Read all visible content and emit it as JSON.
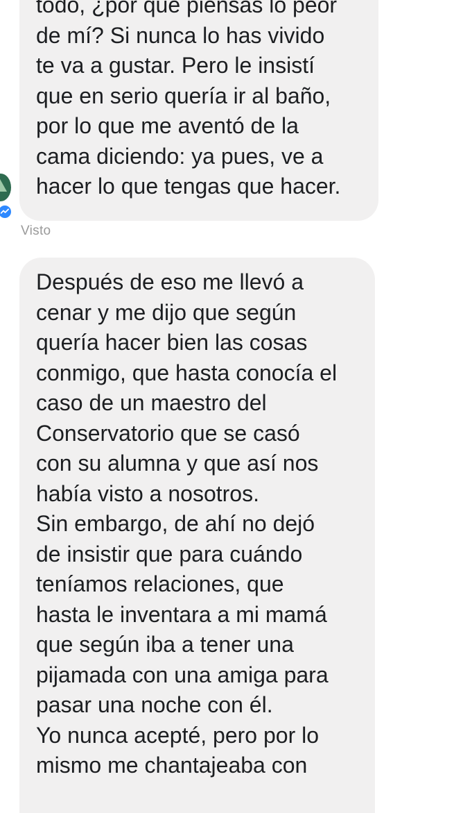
{
  "conversation": {
    "first_message": {
      "lines": [
        "todo, ¿por qué piensas lo peor",
        "de mí? Si nunca lo has vivido",
        "te va a gustar. Pero le insistí",
        "que en serio quería ir al baño,",
        "por lo que me aventó de la",
        "cama diciendo: ya pues, ve a",
        "hacer lo que tengas que hacer."
      ]
    },
    "seen_label": "Visto",
    "second_message": {
      "lines": [
        "Después de eso me llevó a",
        "cenar y me dijo que según",
        "quería hacer bien las cosas",
        "conmigo, que hasta conocía el",
        "caso de un maestro del",
        "Conservatorio que se casó",
        "con su alumna y que así nos",
        "había visto a nosotros.",
        "Sin embargo, de ahí no dejó",
        "de insistir que para cuándo",
        "teníamos relaciones, que",
        "hasta le inventara a mi mamá",
        "que según iba a tener una",
        "pijamada con una amiga para",
        "pasar una noche con él.",
        "Yo nunca acepté, pero por lo",
        "mismo me chantajeaba con"
      ]
    }
  },
  "icons": {
    "avatar": "contact-avatar",
    "badge": "messenger-icon",
    "badge_color": "#2e89ff",
    "top_control": "circle-icon"
  },
  "colors": {
    "bubble_bg": "#f1f0f0",
    "text": "#1c1e21",
    "seen_text": "#9a9a9a"
  }
}
